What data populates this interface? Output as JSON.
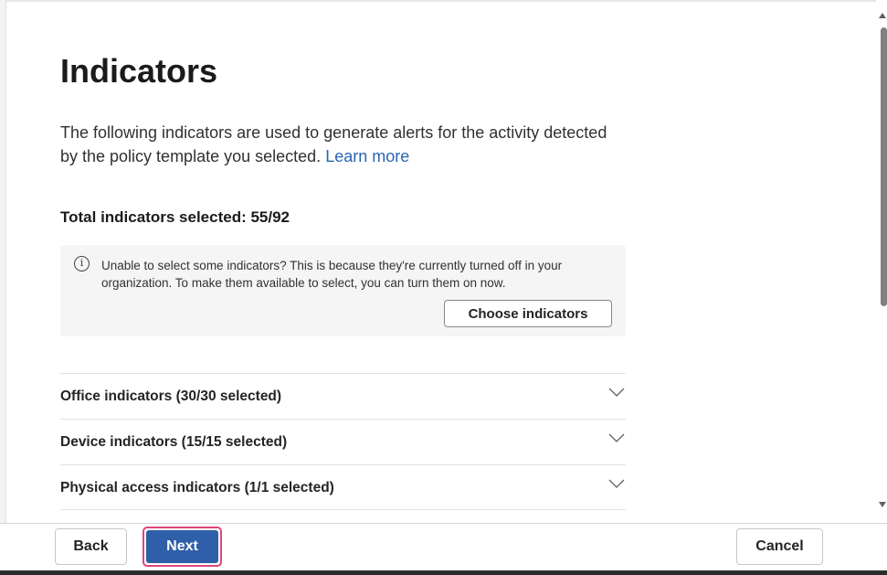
{
  "page": {
    "title": "Indicators",
    "description": "The following indicators are used to generate alerts for the activity detected by the policy template you selected.",
    "learn_more": "Learn more",
    "total_label": "Total indicators selected: 55/92"
  },
  "info": {
    "icon": "info-icon",
    "message": "Unable to select some indicators? This is because they're currently turned off in your organization. To make them available to select, you can turn them on now.",
    "button_label": "Choose indicators"
  },
  "sections": [
    {
      "label": "Office indicators (30/30 selected)",
      "icon": "chevron-down-icon"
    },
    {
      "label": "Device indicators (15/15 selected)",
      "icon": "chevron-down-icon"
    },
    {
      "label": "Physical access indicators (1/1 selected)",
      "icon": "chevron-down-icon"
    }
  ],
  "footer": {
    "back_label": "Back",
    "next_label": "Next",
    "cancel_label": "Cancel"
  },
  "colors": {
    "primary": "#2f5fa8",
    "highlight": "#e0457b",
    "link": "#2b66b1"
  }
}
